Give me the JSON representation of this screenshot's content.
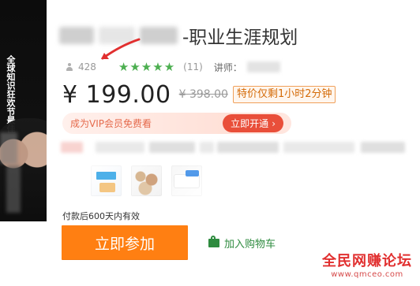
{
  "cover": {
    "vertical_text": "全球知识狂欢节最佳"
  },
  "title": {
    "suffix": "-职业生涯规划"
  },
  "meta": {
    "views": "428",
    "stars": "★★★★★",
    "rating_count": "(11)",
    "lecturer_label": "讲师："
  },
  "price": {
    "current": "¥ 199.00",
    "original": "¥ 398.00",
    "badge": "特价仅剩1小时2分钟"
  },
  "vip": {
    "text": "成为VIP会员免费看",
    "button": "立即开通"
  },
  "validity": {
    "text": "付款后600天内有效"
  },
  "actions": {
    "join": "立即参加",
    "cart": "加入购物车"
  },
  "watermark": {
    "title": "全民网赚论坛",
    "url": "www.qmceo.com"
  },
  "icons": {
    "user": "user-icon",
    "cart": "cart-icon",
    "arrow": "red-arrow-annotation",
    "vip_arrow": "chevron-right-icon"
  },
  "colors": {
    "accent_orange": "#ff7f12",
    "vip_red": "#e94f3a",
    "rating_green": "#4caf50",
    "badge_orange": "#d46b08",
    "watermark_red": "#e12f2f"
  }
}
